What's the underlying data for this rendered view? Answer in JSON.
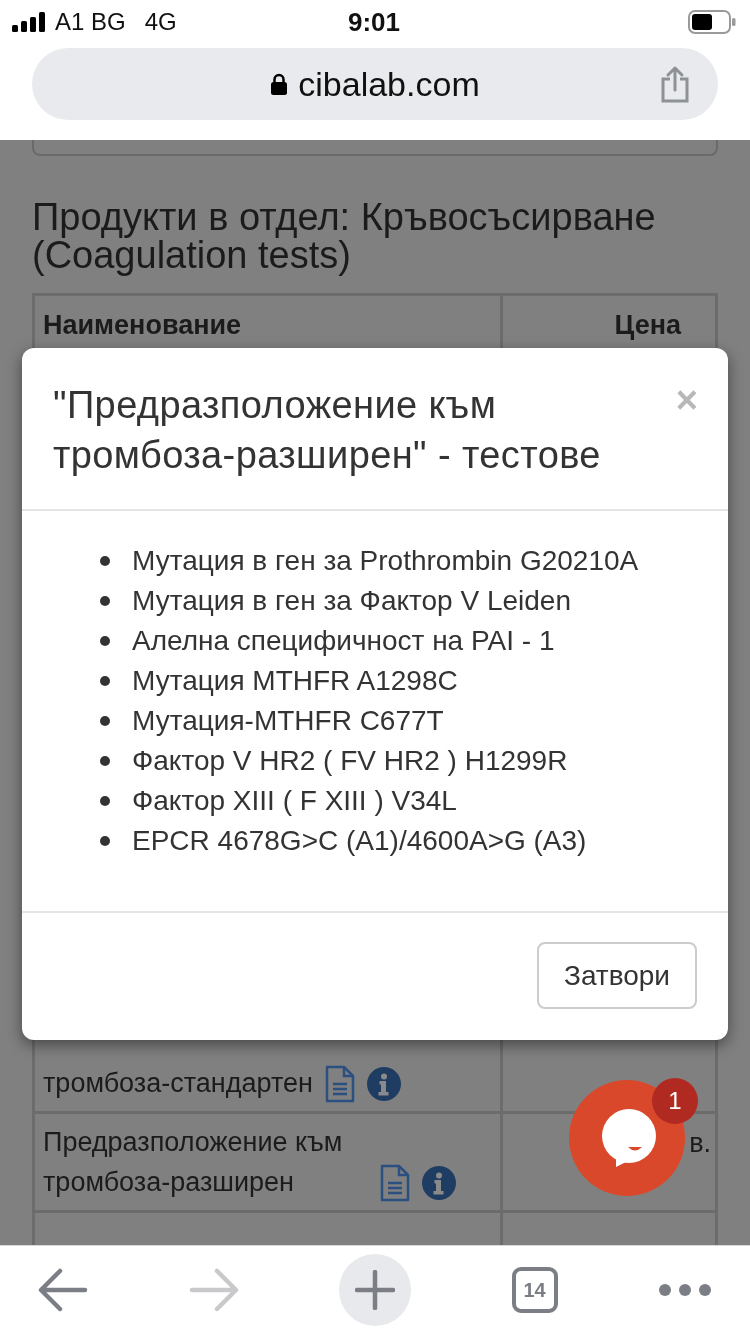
{
  "status_bar": {
    "carrier": "A1 BG",
    "network": "4G",
    "time": "9:01"
  },
  "address_bar": {
    "url": "cibalab.com"
  },
  "page": {
    "heading": "Продукти в отдел: Кръвосъсирване (Coagulation tests)",
    "table": {
      "columns": [
        "Наименование",
        "Цена"
      ],
      "rows": [
        {
          "name": "тромбоза-стандартен",
          "has_info": true
        },
        {
          "name": "Предразположение към тромбоза-разширен",
          "has_info": true,
          "price": "в."
        }
      ]
    }
  },
  "modal": {
    "title": "\"Предразположение към тромбоза-разширен\" - тестове",
    "close": "×",
    "tests": [
      "Мутация в ген за Prothrombin G20210A",
      "Мутация в ген за Фактор V Leiden",
      "Алелна специфичност на PAI - 1",
      "Мутация MTHFR A1298C",
      "Мутация-MTHFR C677T",
      "Фактор V HR2 ( FV HR2 ) H1299R",
      "Фактор XIII ( F XIII ) V34L",
      "EPCR 4678G>C (A1)/4600A>G (A3)"
    ],
    "buttons": [
      "Затвори"
    ]
  },
  "chat_button": {
    "badge": "1"
  },
  "toolbar": {
    "buttons": [
      {
        "kind": "back",
        "disabled": false
      },
      {
        "kind": "forward",
        "disabled": true
      },
      {
        "kind": "new-tab"
      },
      {
        "kind": "tabs",
        "label": "14"
      },
      {
        "kind": "more"
      }
    ]
  }
}
